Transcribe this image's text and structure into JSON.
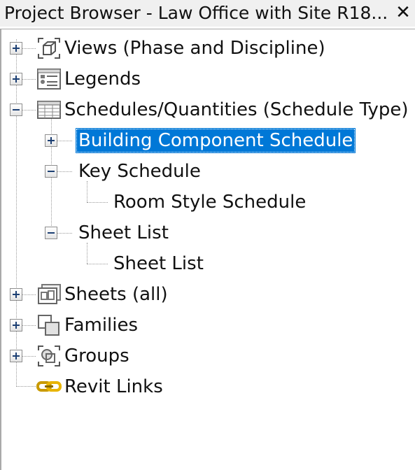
{
  "window": {
    "title": "Project Browser - Law Office with Site R18..."
  },
  "tree": {
    "views": "Views (Phase and Discipline)",
    "legends": "Legends",
    "schedules": "Schedules/Quantities (Schedule Type)",
    "building_component_schedule": "Building Component Schedule",
    "key_schedule": "Key Schedule",
    "room_style_schedule": "Room Style Schedule",
    "sheet_list_group": "Sheet List",
    "sheet_list_item": "Sheet List",
    "sheets": "Sheets (all)",
    "families": "Families",
    "groups": "Groups",
    "revit_links": "Revit Links"
  },
  "icons": {
    "views": "views-3d-box-icon",
    "legends": "legend-icon",
    "schedules": "schedule-table-icon",
    "sheets": "sheets-icon",
    "families": "families-icon",
    "groups": "groups-icon",
    "revit_links": "revit-links-chain-icon"
  },
  "colors": {
    "selection": "#0078d7",
    "link_icon": "#e8b400"
  }
}
